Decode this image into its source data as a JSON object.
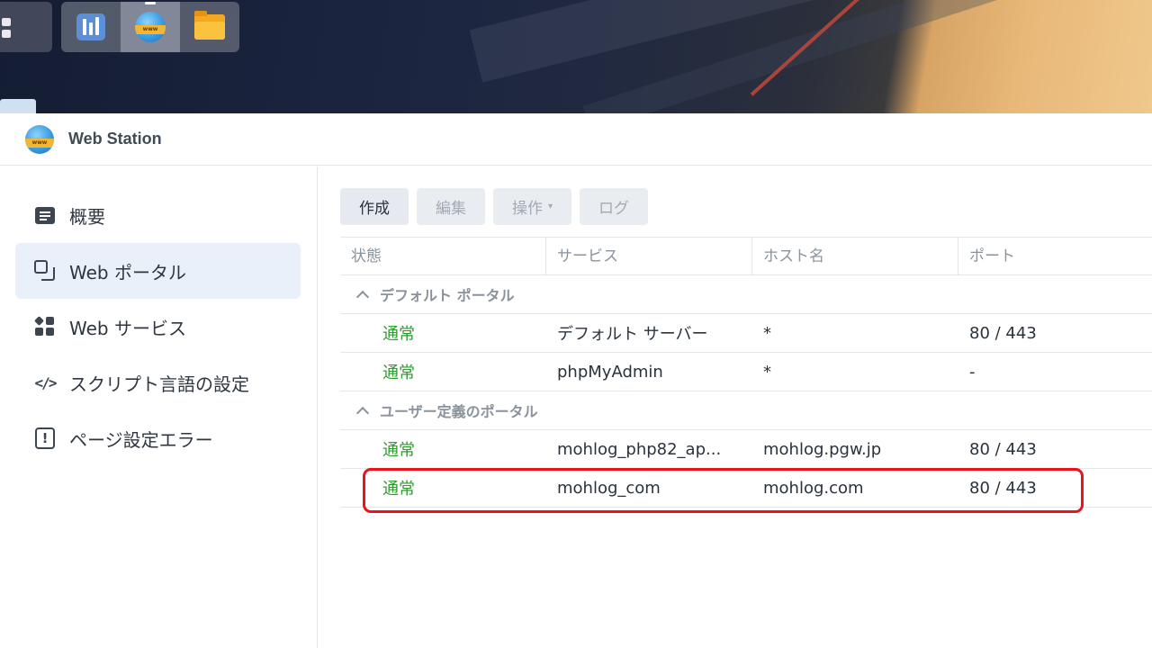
{
  "app": {
    "title": "Web Station"
  },
  "taskbar": {
    "apps": [
      {
        "icon": "control-panel-icon"
      },
      {
        "icon": "web-station-icon",
        "active": true
      },
      {
        "icon": "file-station-icon"
      }
    ],
    "globe_badge": "www"
  },
  "sidebar": {
    "items": [
      {
        "label": "概要",
        "icon": "overview-icon"
      },
      {
        "label": "Web ポータル",
        "icon": "web-portal-icon",
        "active": true
      },
      {
        "label": "Web サービス",
        "icon": "web-services-icon"
      },
      {
        "label": "スクリプト言語の設定",
        "icon": "code-icon",
        "icon_glyph": "</>"
      },
      {
        "label": "ページ設定エラー",
        "icon": "alert-icon",
        "icon_glyph": "!"
      }
    ]
  },
  "toolbar": {
    "create": "作成",
    "edit": "編集",
    "action": "操作",
    "action_caret": "▾",
    "log": "ログ"
  },
  "table": {
    "headers": [
      "状態",
      "サービス",
      "ホスト名",
      "ポート"
    ],
    "groups": [
      {
        "label": "デフォルト ポータル",
        "rows": [
          {
            "status": "通常",
            "service": "デフォルト サーバー",
            "host": "*",
            "port": "80 / 443"
          },
          {
            "status": "通常",
            "service": "phpMyAdmin",
            "host": "*",
            "port": "-"
          }
        ]
      },
      {
        "label": "ユーザー定義のポータル",
        "rows": [
          {
            "status": "通常",
            "service": "mohlog_php82_ap...",
            "host": "mohlog.pgw.jp",
            "port": "80 / 443"
          },
          {
            "status": "通常",
            "service": "mohlog_com",
            "host": "mohlog.com",
            "port": "80 / 443",
            "highlighted": true
          }
        ]
      }
    ]
  },
  "colors": {
    "status_ok": "#2f9a2f",
    "highlight_border": "#e8131b",
    "active_nav_bg": "#e9f0fa"
  }
}
